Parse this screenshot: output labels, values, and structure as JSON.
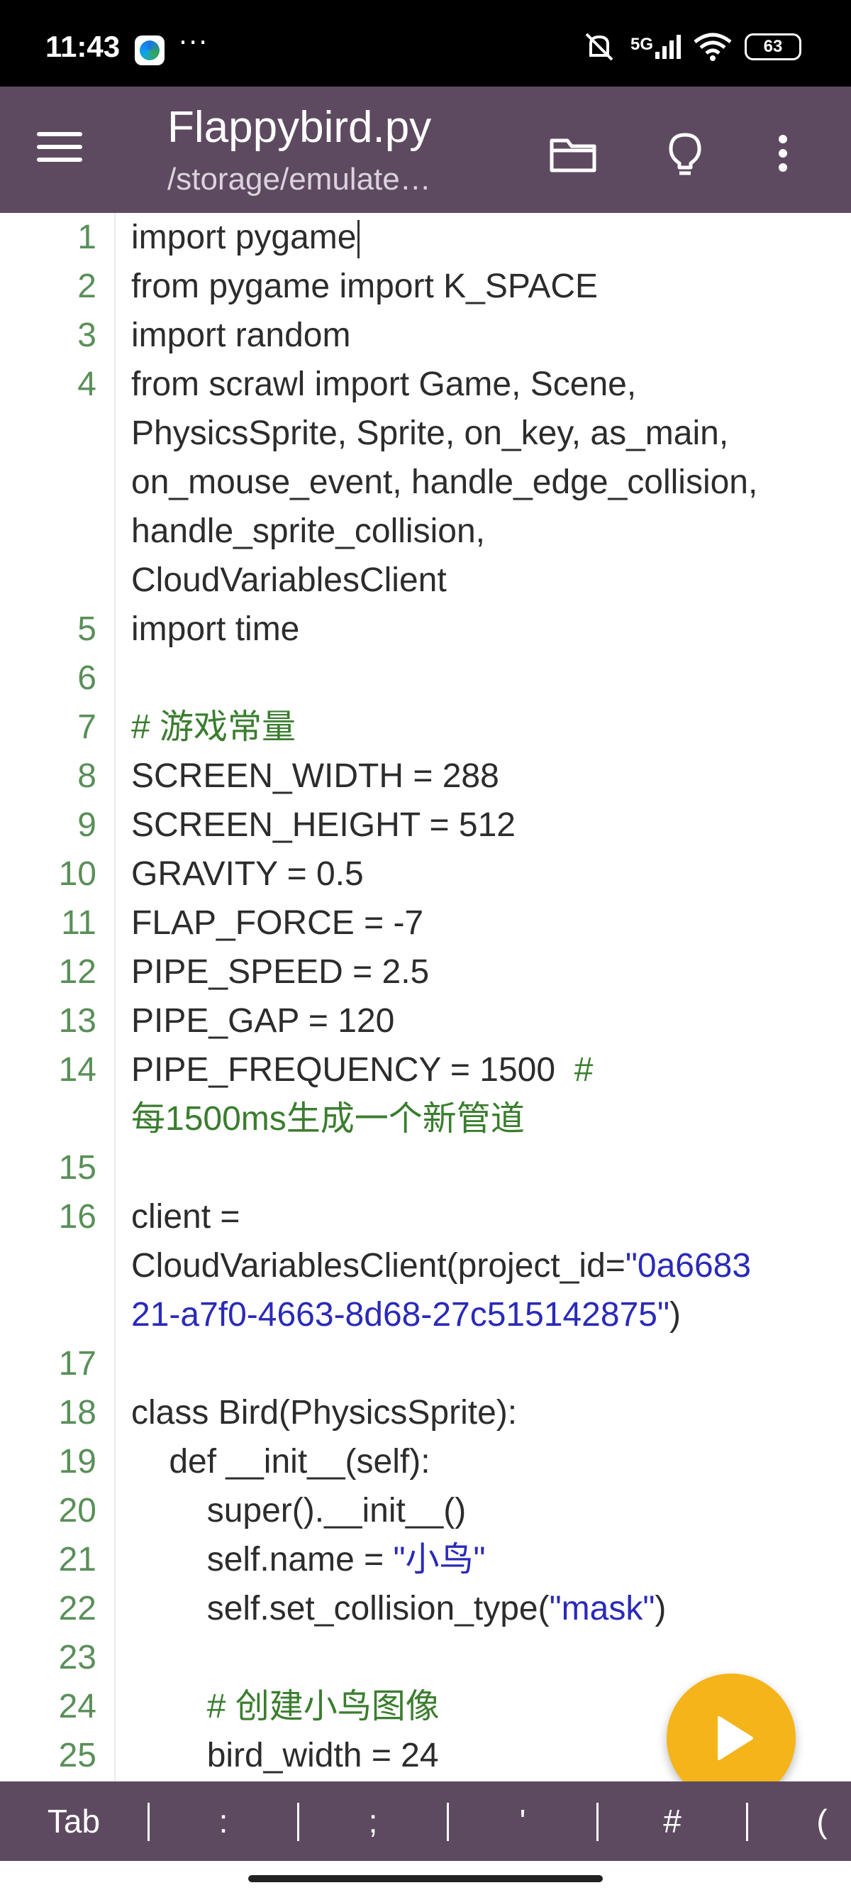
{
  "status_bar": {
    "time": "11:43",
    "more_dots": "···",
    "network": "5G",
    "battery": "63"
  },
  "app_bar": {
    "title": "Flappybird.py",
    "subtitle": "/storage/emulate…",
    "icons": [
      "menu-icon",
      "folder-icon",
      "lightbulb-icon",
      "more-vert-icon"
    ]
  },
  "editor": {
    "lines": [
      {
        "n": "1",
        "segs": [
          {
            "t": "import pygame",
            "c": ""
          }
        ]
      },
      {
        "n": "2",
        "segs": [
          {
            "t": "from pygame import K_SPACE",
            "c": ""
          }
        ]
      },
      {
        "n": "3",
        "segs": [
          {
            "t": "import random",
            "c": ""
          }
        ]
      },
      {
        "n": "4",
        "segs": [
          {
            "t": "from scrawl import Game, Scene,",
            "c": ""
          }
        ]
      },
      {
        "n": "",
        "segs": [
          {
            "t": "PhysicsSprite, Sprite, on_key, as_main,",
            "c": ""
          }
        ]
      },
      {
        "n": "",
        "segs": [
          {
            "t": "on_mouse_event, handle_edge_collision,",
            "c": ""
          }
        ]
      },
      {
        "n": "",
        "segs": [
          {
            "t": "handle_sprite_collision,",
            "c": ""
          }
        ]
      },
      {
        "n": "",
        "segs": [
          {
            "t": "CloudVariablesClient",
            "c": ""
          }
        ]
      },
      {
        "n": "5",
        "segs": [
          {
            "t": "import time",
            "c": ""
          }
        ]
      },
      {
        "n": "6",
        "segs": []
      },
      {
        "n": "7",
        "segs": [
          {
            "t": "# 游戏常量",
            "c": "cmt"
          }
        ]
      },
      {
        "n": "8",
        "segs": [
          {
            "t": "SCREEN_WIDTH = 288",
            "c": ""
          }
        ]
      },
      {
        "n": "9",
        "segs": [
          {
            "t": "SCREEN_HEIGHT = 512",
            "c": ""
          }
        ]
      },
      {
        "n": "10",
        "segs": [
          {
            "t": "GRAVITY = 0.5",
            "c": ""
          }
        ]
      },
      {
        "n": "11",
        "segs": [
          {
            "t": "FLAP_FORCE = -7",
            "c": ""
          }
        ]
      },
      {
        "n": "12",
        "segs": [
          {
            "t": "PIPE_SPEED = 2.5",
            "c": ""
          }
        ]
      },
      {
        "n": "13",
        "segs": [
          {
            "t": "PIPE_GAP = 120",
            "c": ""
          }
        ]
      },
      {
        "n": "14",
        "segs": [
          {
            "t": "PIPE_FREQUENCY = 1500  ",
            "c": ""
          },
          {
            "t": "#",
            "c": "cmt"
          }
        ]
      },
      {
        "n": "",
        "segs": [
          {
            "t": "每1500ms生成一个新管道",
            "c": "cmt"
          }
        ]
      },
      {
        "n": "15",
        "segs": []
      },
      {
        "n": "16",
        "segs": [
          {
            "t": "client =",
            "c": ""
          }
        ]
      },
      {
        "n": "",
        "segs": [
          {
            "t": "CloudVariablesClient(project_id=",
            "c": ""
          },
          {
            "t": "\"0a6683",
            "c": "str"
          }
        ]
      },
      {
        "n": "",
        "segs": [
          {
            "t": "21-a7f0-4663-8d68-27c515142875\"",
            "c": "str"
          },
          {
            "t": ")",
            "c": ""
          }
        ]
      },
      {
        "n": "17",
        "segs": []
      },
      {
        "n": "18",
        "segs": [
          {
            "t": "class Bird(PhysicsSprite):",
            "c": ""
          }
        ]
      },
      {
        "n": "19",
        "segs": [
          {
            "t": "    def __init__(self):",
            "c": ""
          }
        ]
      },
      {
        "n": "20",
        "segs": [
          {
            "t": "        super().__init__()",
            "c": ""
          }
        ]
      },
      {
        "n": "21",
        "segs": [
          {
            "t": "        self.name = ",
            "c": ""
          },
          {
            "t": "\"小鸟\"",
            "c": "str"
          }
        ]
      },
      {
        "n": "22",
        "segs": [
          {
            "t": "        self.set_collision_type(",
            "c": ""
          },
          {
            "t": "\"mask\"",
            "c": "str"
          },
          {
            "t": ")",
            "c": ""
          }
        ]
      },
      {
        "n": "23",
        "segs": []
      },
      {
        "n": "24",
        "segs": [
          {
            "t": "        # 创建小鸟图像",
            "c": "cmt"
          }
        ]
      },
      {
        "n": "25",
        "segs": [
          {
            "t": "        bird_width = 24",
            "c": ""
          }
        ]
      }
    ]
  },
  "fab": {
    "icon": "play-icon"
  },
  "symbol_bar": {
    "keys": [
      "Tab",
      ":",
      ";",
      "'",
      "#",
      "("
    ]
  }
}
